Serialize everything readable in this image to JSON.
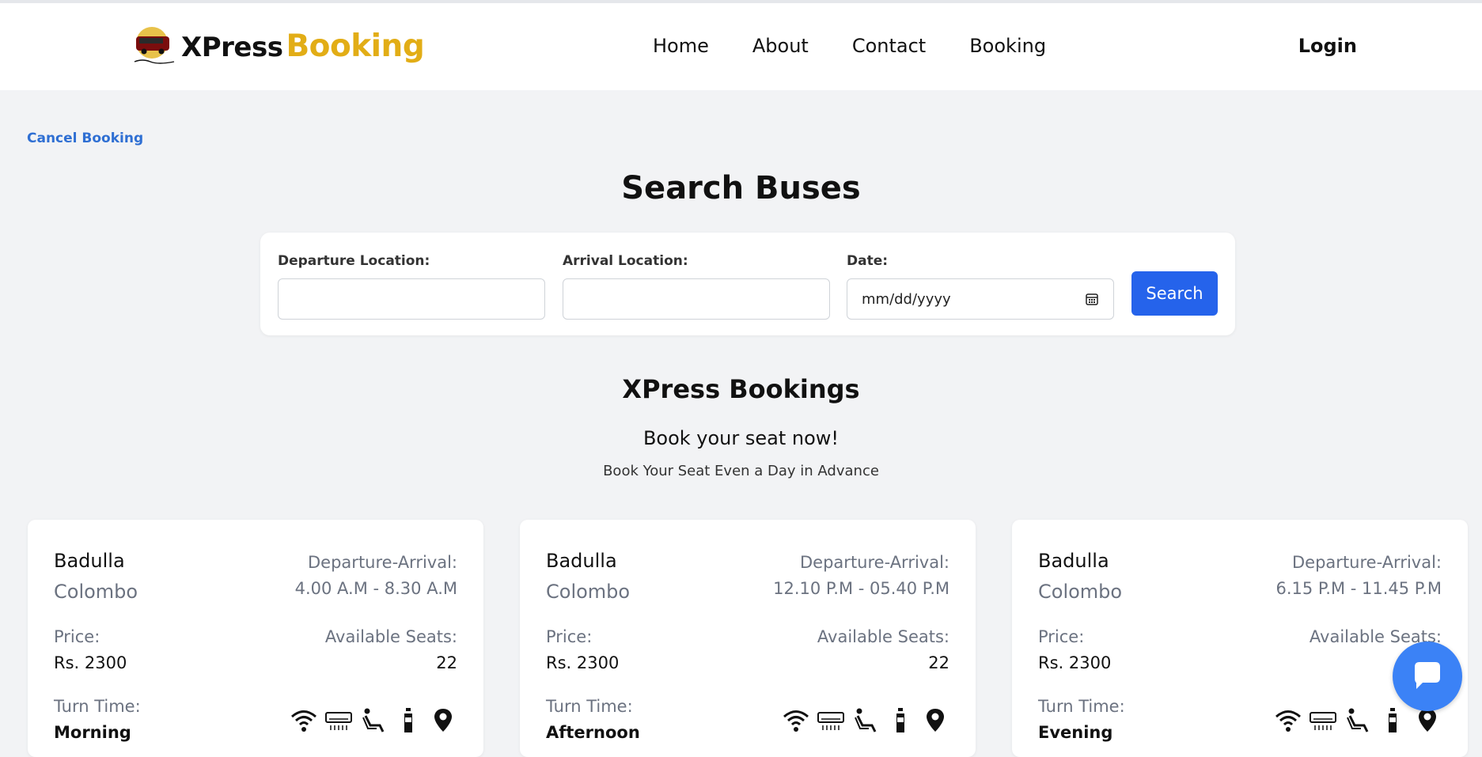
{
  "brand": {
    "name_part1": "XPress",
    "name_part2": "Booking",
    "accent_color": "#e2ad16"
  },
  "nav": {
    "items": [
      "Home",
      "About",
      "Contact",
      "Booking"
    ],
    "login_label": "Login"
  },
  "cancel_link": "Cancel Booking",
  "search": {
    "title": "Search Buses",
    "departure_label": "Departure Location:",
    "departure_value": "",
    "arrival_label": "Arrival Location:",
    "arrival_value": "",
    "date_label": "Date:",
    "date_placeholder": "mm/dd/yyyy",
    "button_label": "Search",
    "button_color": "#2563eb"
  },
  "section": {
    "title": "XPress Bookings",
    "subtitle": "Book your seat now!",
    "caption": "Book Your Seat Even a Day in Advance"
  },
  "cards": [
    {
      "from": "Badulla",
      "to": "Colombo",
      "da_label": "Departure-Arrival:",
      "da_value": "4.00 A.M - 8.30 A.M",
      "price_label": "Price:",
      "price": "Rs. 2300",
      "seats_label": "Available Seats:",
      "seats": "22",
      "turn_label": "Turn Time:",
      "turn": "Morning",
      "amenities": [
        "wifi-icon",
        "ac-icon",
        "reclining-seat-icon",
        "water-bottle-icon",
        "location-pin-icon"
      ]
    },
    {
      "from": "Badulla",
      "to": "Colombo",
      "da_label": "Departure-Arrival:",
      "da_value": "12.10 P.M - 05.40 P.M",
      "price_label": "Price:",
      "price": "Rs. 2300",
      "seats_label": "Available Seats:",
      "seats": "22",
      "turn_label": "Turn Time:",
      "turn": "Afternoon",
      "amenities": [
        "wifi-icon",
        "ac-icon",
        "reclining-seat-icon",
        "water-bottle-icon",
        "location-pin-icon"
      ]
    },
    {
      "from": "Badulla",
      "to": "Colombo",
      "da_label": "Departure-Arrival:",
      "da_value": "6.15 P.M - 11.45 P.M",
      "price_label": "Price:",
      "price": "Rs. 2300",
      "seats_label": "Available Seats:",
      "seats": "",
      "turn_label": "Turn Time:",
      "turn": "Evening",
      "amenities": [
        "wifi-icon",
        "ac-icon",
        "reclining-seat-icon",
        "water-bottle-icon",
        "location-pin-icon"
      ]
    }
  ],
  "chat": {
    "icon": "chat-bubble-icon",
    "color": "#3b82f6"
  }
}
